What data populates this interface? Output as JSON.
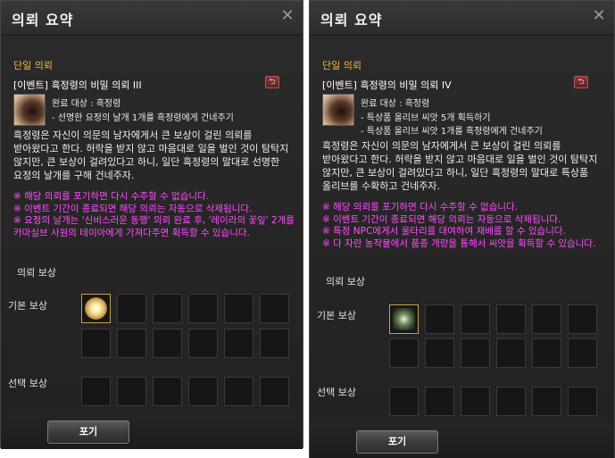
{
  "left": {
    "title": "의뢰 요약",
    "close_glyph": "✕",
    "category": "단일 의뢰",
    "quest_title": "[이벤트] 흑정령의 비밀 의뢰 III",
    "target_label": "완료 대상 : 흑정령",
    "objectives": [
      "- 선명한 요정의 날개 1개를 흑정령에게 건네주기"
    ],
    "description": "흑정령은 자신이 의문의 남자에게서 큰 보상이 걸린 의뢰를 받아왔다고 한다. 허락을 받지 않고 마음대로 일을 벌인 것이 탐탁지 않지만, 큰 보상이 걸려있다고 하니, 일단 흑정령의 말대로 선명한 요정의 날개를 구해 건네주자.",
    "warnings": [
      "※ 해당 의뢰를 포기하면 다시 수주할 수 없습니다.",
      "※ 이벤트 기간이 종료되면 해당 의뢰는 자동으로 삭제됩니다.",
      "※ 요정의 날개는 '신비스러운 동행' 의뢰 완료 후, '레이라의 꽃잎' 2개를 카마실브 사원의 테이아에게 가져다주면 획득할 수 있습니다."
    ],
    "reward_heading": "의뢰 보상",
    "basic_reward_label": "기본 보상",
    "select_reward_label": "선택 보상",
    "abandon_button": "포기",
    "basic_reward_item_icon": "glowing-orb-icon"
  },
  "right": {
    "title": "의뢰 요약",
    "close_glyph": "✕",
    "category": "단일 의뢰",
    "quest_title": "[이벤트] 흑정령의 비밀 의뢰 IV",
    "target_label": "완료 대상 : 흑정령",
    "objectives": [
      "- 특상품 올리브 씨앗 5개 획득하기",
      "- 특상품 올리브 씨앗 1개를 흑정령에게 건네주기"
    ],
    "description": "흑정령은 자신이 의문의 남자에게서 큰 보상이 걸린 의뢰를 받아왔다고 한다. 허락을 받지 않고 마음대로 일을 벌인 것이 탐탁지 않지만, 큰 보상이 걸려있다고 하니, 일단 흑정령의 말대로 특상품 올리브를 수확하고 건네주자.",
    "warnings": [
      "※ 해당 의뢰를 포기하면 다시 수주할 수 없습니다.",
      "※ 이벤트 기간이 종료되면 해당 의뢰는 자동으로 삭제됩니다.",
      "※ 특정 NPC에게서 울타리를 대여하여 재배를 할 수 있습니다.",
      "※ 다 자란 농작물에서 품종 개량을 통해서 씨앗을 획득할 수 있습니다."
    ],
    "reward_heading": "의뢰 보상",
    "basic_reward_label": "기본 보상",
    "select_reward_label": "선택 보상",
    "abandon_button": "포기",
    "basic_reward_item_icon": "olive-seed-icon"
  },
  "colors": {
    "category": "#f0b93a",
    "warning": "#ff4dff",
    "panel_bg": "#2a2929",
    "item_border": "#c8a14a"
  },
  "icons": {
    "abandon_icon": "return-arrow-icon",
    "close_icon": "close-icon"
  }
}
